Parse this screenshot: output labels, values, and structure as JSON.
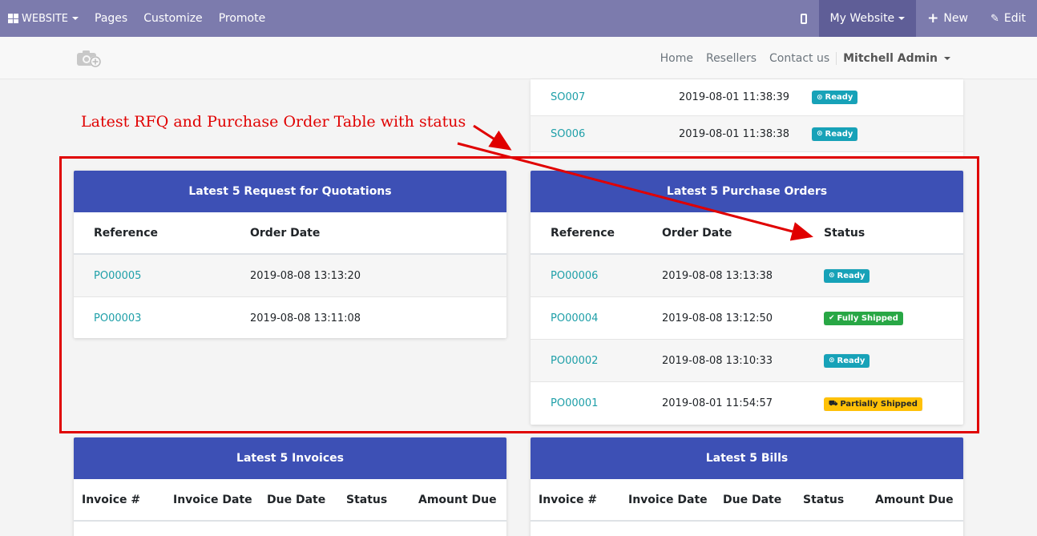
{
  "topbar": {
    "brand": "WEBSITE",
    "nav": [
      "Pages",
      "Customize",
      "Promote"
    ],
    "site_selector": "My Website",
    "new_label": "New",
    "edit_label": "Edit"
  },
  "sitenav": {
    "links": [
      "Home",
      "Resellers",
      "Contact us"
    ],
    "user": "Mitchell Admin"
  },
  "sales_partial": {
    "rows": [
      {
        "ref": "SO007",
        "date": "2019-08-01 11:38:39",
        "status": "Ready"
      },
      {
        "ref": "SO006",
        "date": "2019-08-01 11:38:38",
        "status": "Ready"
      }
    ]
  },
  "annotation": {
    "text": "Latest RFQ and Purchase Order Table with status",
    "color": "#e00000"
  },
  "rfq": {
    "title": "Latest 5 Request for Quotations",
    "headers": [
      "Reference",
      "Order Date"
    ],
    "rows": [
      {
        "ref": "PO00005",
        "date": "2019-08-08 13:13:20"
      },
      {
        "ref": "PO00003",
        "date": "2019-08-08 13:11:08"
      }
    ]
  },
  "po": {
    "title": "Latest 5 Purchase Orders",
    "headers": [
      "Reference",
      "Order Date",
      "Status"
    ],
    "rows": [
      {
        "ref": "PO00006",
        "date": "2019-08-08 13:13:38",
        "status": "Ready",
        "kind": "info"
      },
      {
        "ref": "PO00004",
        "date": "2019-08-08 13:12:50",
        "status": "Fully Shipped",
        "kind": "success"
      },
      {
        "ref": "PO00002",
        "date": "2019-08-08 13:10:33",
        "status": "Ready",
        "kind": "info"
      },
      {
        "ref": "PO00001",
        "date": "2019-08-01 11:54:57",
        "status": "Partially Shipped",
        "kind": "warning"
      }
    ]
  },
  "invoices": {
    "title": "Latest 5 Invoices",
    "headers": [
      "Invoice #",
      "Invoice Date",
      "Due Date",
      "Status",
      "Amount Due"
    ]
  },
  "bills": {
    "title": "Latest 5 Bills",
    "headers": [
      "Invoice #",
      "Invoice Date",
      "Due Date",
      "Status",
      "Amount Due"
    ]
  },
  "colors": {
    "topbar": "#7c7bad",
    "card_header": "#3d50b5",
    "link": "#1e9fa8",
    "badge_info": "#17a2b8",
    "badge_success": "#28a745",
    "badge_warning": "#ffc107"
  }
}
